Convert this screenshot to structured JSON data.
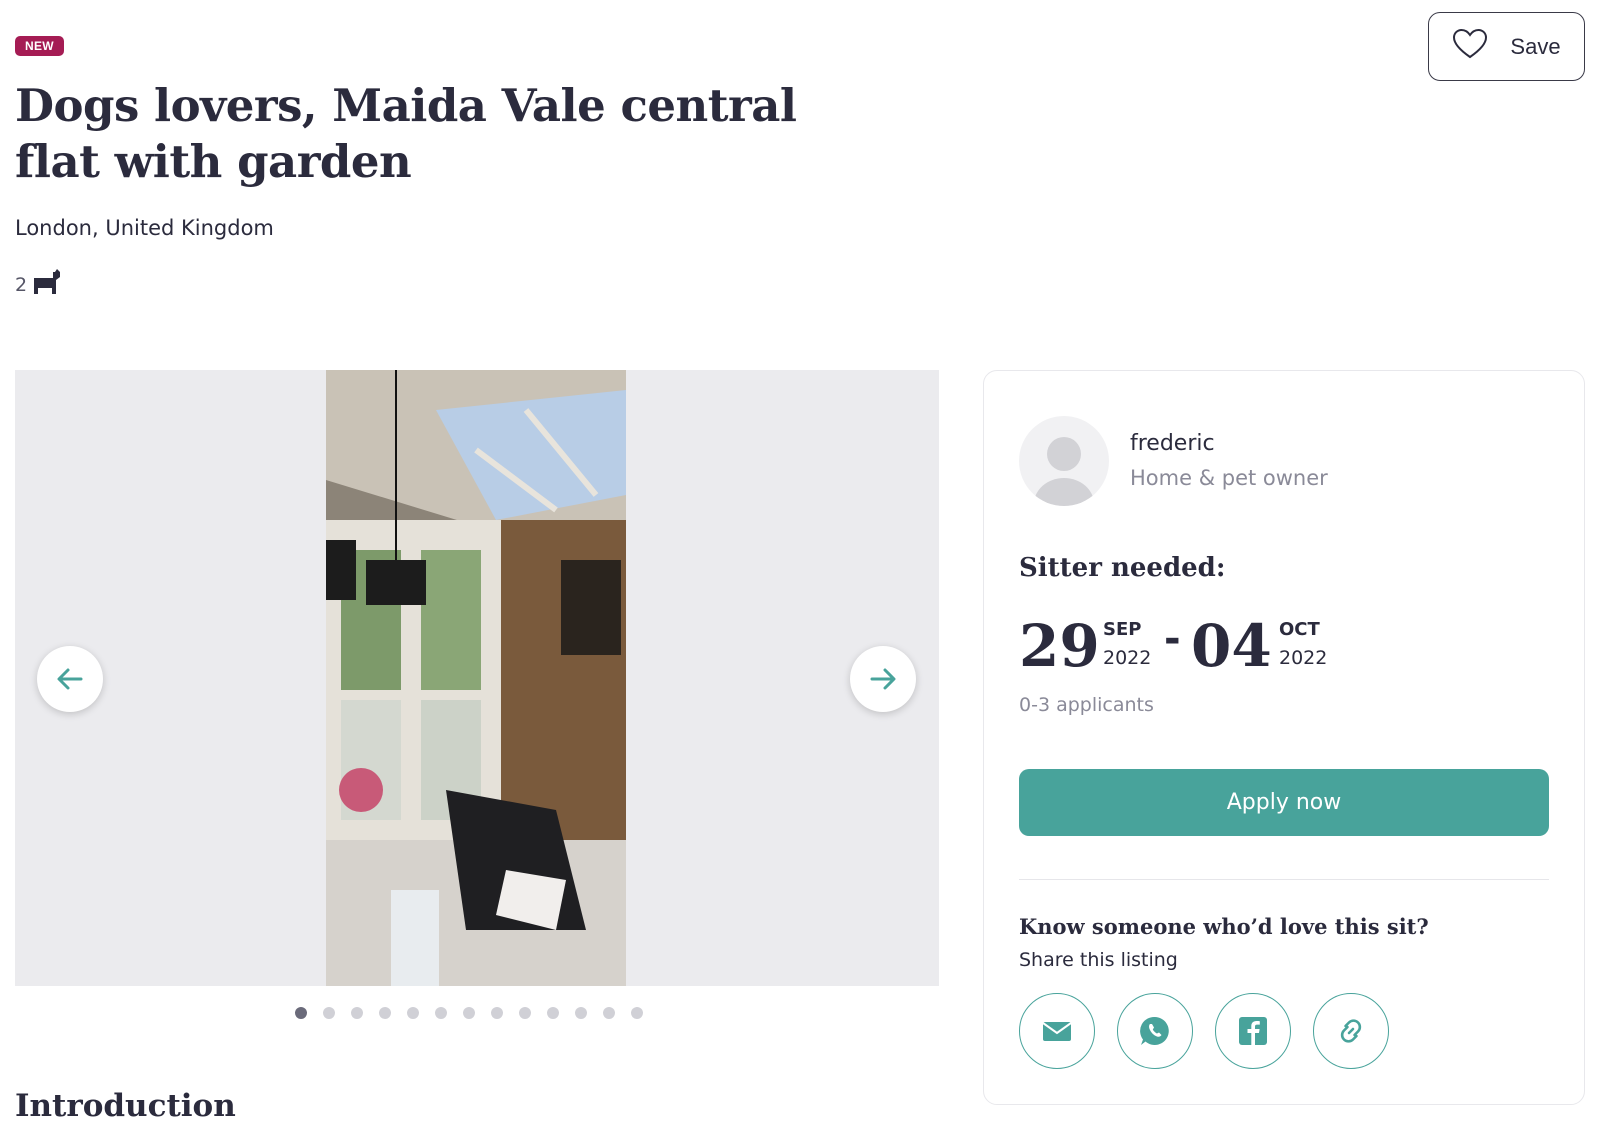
{
  "listing": {
    "badge": "NEW",
    "title": "Dogs lovers, Maida Vale central flat with garden",
    "location": "London, United Kingdom",
    "pet_count": "2"
  },
  "save_label": "Save",
  "gallery": {
    "dot_count": 13,
    "active_index": 0
  },
  "owner": {
    "name": "frederic",
    "role": "Home & pet owner"
  },
  "sitter": {
    "heading": "Sitter needed:",
    "start": {
      "day": "29",
      "month": "SEP",
      "year": "2022"
    },
    "dash": "-",
    "end": {
      "day": "04",
      "month": "OCT",
      "year": "2022"
    },
    "applicants": "0-3 applicants"
  },
  "apply_label": "Apply now",
  "share": {
    "heading": "Know someone who’d love this sit?",
    "subtitle": "Share this listing",
    "icons": [
      "email-icon",
      "whatsapp-icon",
      "facebook-icon",
      "link-icon"
    ]
  },
  "intro_heading": "Introduction",
  "colors": {
    "accent": "#48a39b",
    "badge": "#a51c54",
    "text": "#2b2b3d"
  }
}
